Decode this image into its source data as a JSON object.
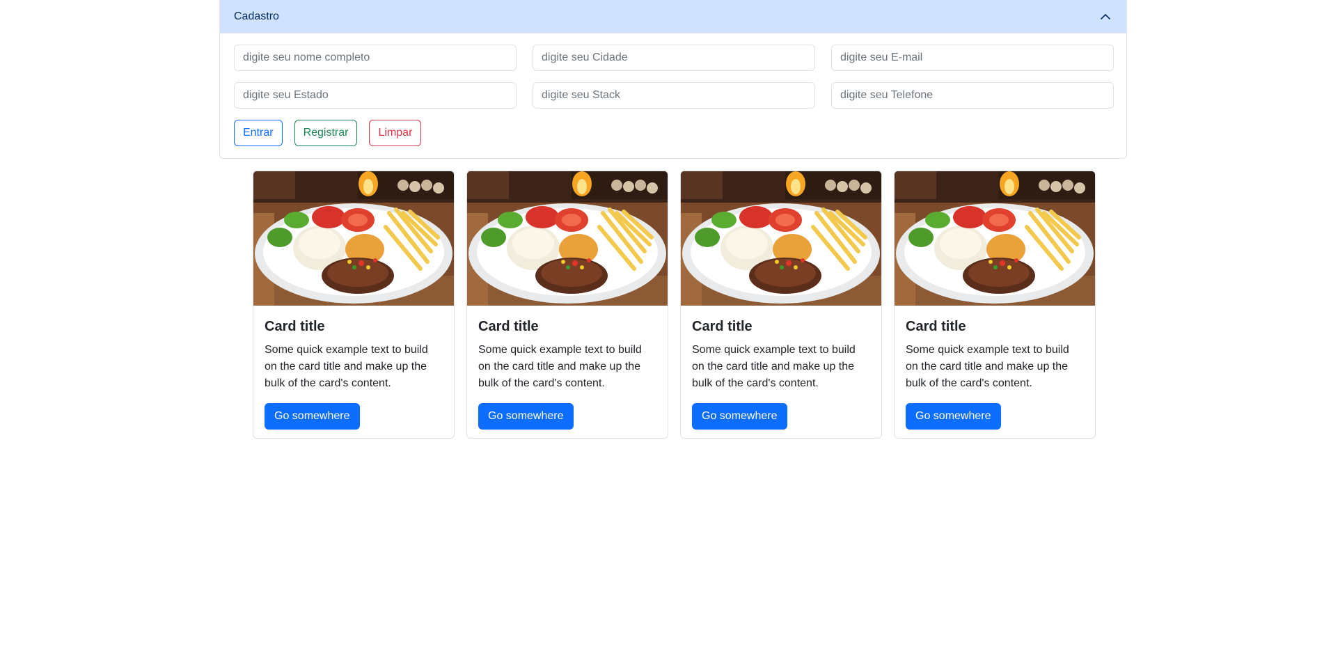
{
  "accordion": {
    "title": "Cadastro",
    "expanded": true,
    "toggle_icon": "chevron-up-icon",
    "header_color": "#cfe2ff"
  },
  "form": {
    "fields": {
      "nome": {
        "placeholder": "digite seu nome completo",
        "value": ""
      },
      "cidade": {
        "placeholder": "digite seu Cidade",
        "value": ""
      },
      "email": {
        "placeholder": "digite seu E-mail",
        "value": ""
      },
      "estado": {
        "placeholder": "digite seu Estado",
        "value": ""
      },
      "stack": {
        "placeholder": "digite seu Stack",
        "value": ""
      },
      "telefone": {
        "placeholder": "digite seu Telefone",
        "value": ""
      }
    },
    "buttons": {
      "entrar": "Entrar",
      "registrar": "Registrar",
      "limpar": "Limpar"
    }
  },
  "colors": {
    "primary": "#0d6efd",
    "success": "#198754",
    "danger": "#dc3545"
  },
  "cards": [
    {
      "title": "Card title",
      "text": "Some quick example text to build on the card title and make up the bulk of the card's content.",
      "button": "Go somewhere",
      "image": "food-plate-image"
    },
    {
      "title": "Card title",
      "text": "Some quick example text to build on the card title and make up the bulk of the card's content.",
      "button": "Go somewhere",
      "image": "food-plate-image"
    },
    {
      "title": "Card title",
      "text": "Some quick example text to build on the card title and make up the bulk of the card's content.",
      "button": "Go somewhere",
      "image": "food-plate-image"
    },
    {
      "title": "Card title",
      "text": "Some quick example text to build on the card title and make up the bulk of the card's content.",
      "button": "Go somewhere",
      "image": "food-plate-image"
    }
  ]
}
